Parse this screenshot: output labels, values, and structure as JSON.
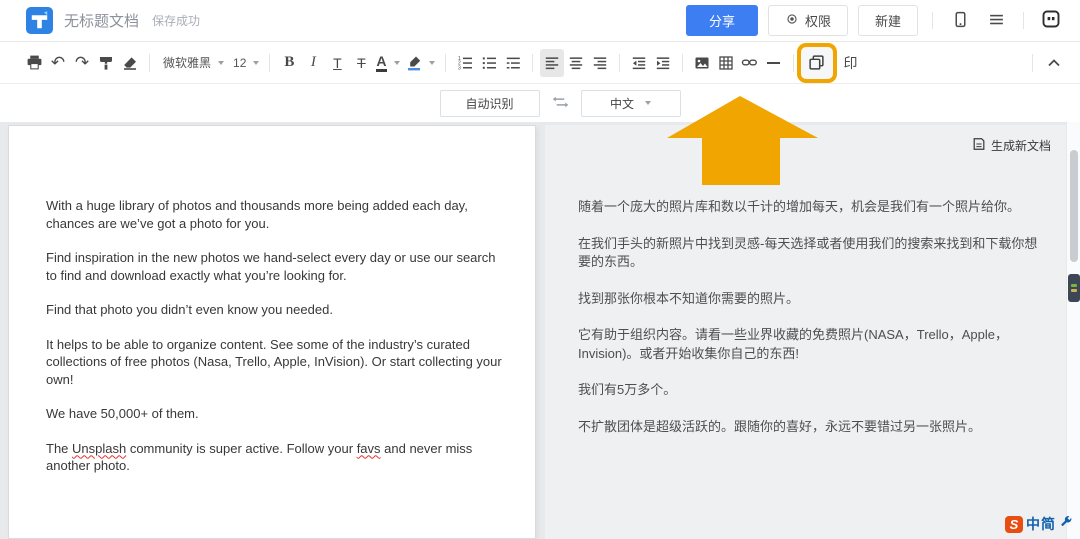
{
  "topbar": {
    "title": "无标题文档",
    "status": "保存成功",
    "share": "分享",
    "permission": "权限",
    "new_doc": "新建"
  },
  "toolbar": {
    "undo_glyph": "↶",
    "redo_glyph": "↷",
    "font_name": "微软雅黑",
    "font_size": "12",
    "bold": "B",
    "italic": "I",
    "underline": "T",
    "strikethrough": "T",
    "font_color": "A",
    "stamp": "印"
  },
  "langbar": {
    "source": "自动识别",
    "target": "中文"
  },
  "panel": {
    "generate": "生成新文档"
  },
  "doc_en": {
    "p1": "With a huge library of photos and thousands more being added each day, chances are we’ve got a photo for you.",
    "p2": "Find inspiration in the new photos we hand-select every day or use our search to find and download exactly what you’re looking for.",
    "p3": "Find that photo you didn’t even know you needed.",
    "p4": "It helps to be able to organize content. See some of the industry’s curated collections of free photos (Nasa, Trello, Apple, InVision). Or start collecting your own!",
    "p5": "We have 50,000+ of them.",
    "p6a": "The ",
    "p6w1": "Unsplash",
    "p6b": " community is super active. Follow your ",
    "p6w2": "favs",
    "p6c": " and never miss another photo."
  },
  "doc_zh": {
    "p1": "随着一个庞大的照片库和数以千计的增加每天，机会是我们有一个照片给你。",
    "p2": "在我们手头的新照片中找到灵感-每天选择或者使用我们的搜索来找到和下载你想要的东西。",
    "p3": "找到那张你根本不知道你需要的照片。",
    "p4": "它有助于组织内容。请看一些业界收藏的免费照片(NASA，Trello，Apple，Invision)。或者开始收集你自己的东西!",
    "p5": "我们有5万多个。",
    "p6": "不扩散团体是超级活跃的。跟随你的喜好，永远不要错过另一张照片。"
  },
  "watermark": {
    "letter": "S",
    "brand": "中简"
  },
  "colors": {
    "accent_blue": "#3D7EF2",
    "annotation_amber": "#F0A500",
    "spellcheck_red": "#E5302F"
  }
}
